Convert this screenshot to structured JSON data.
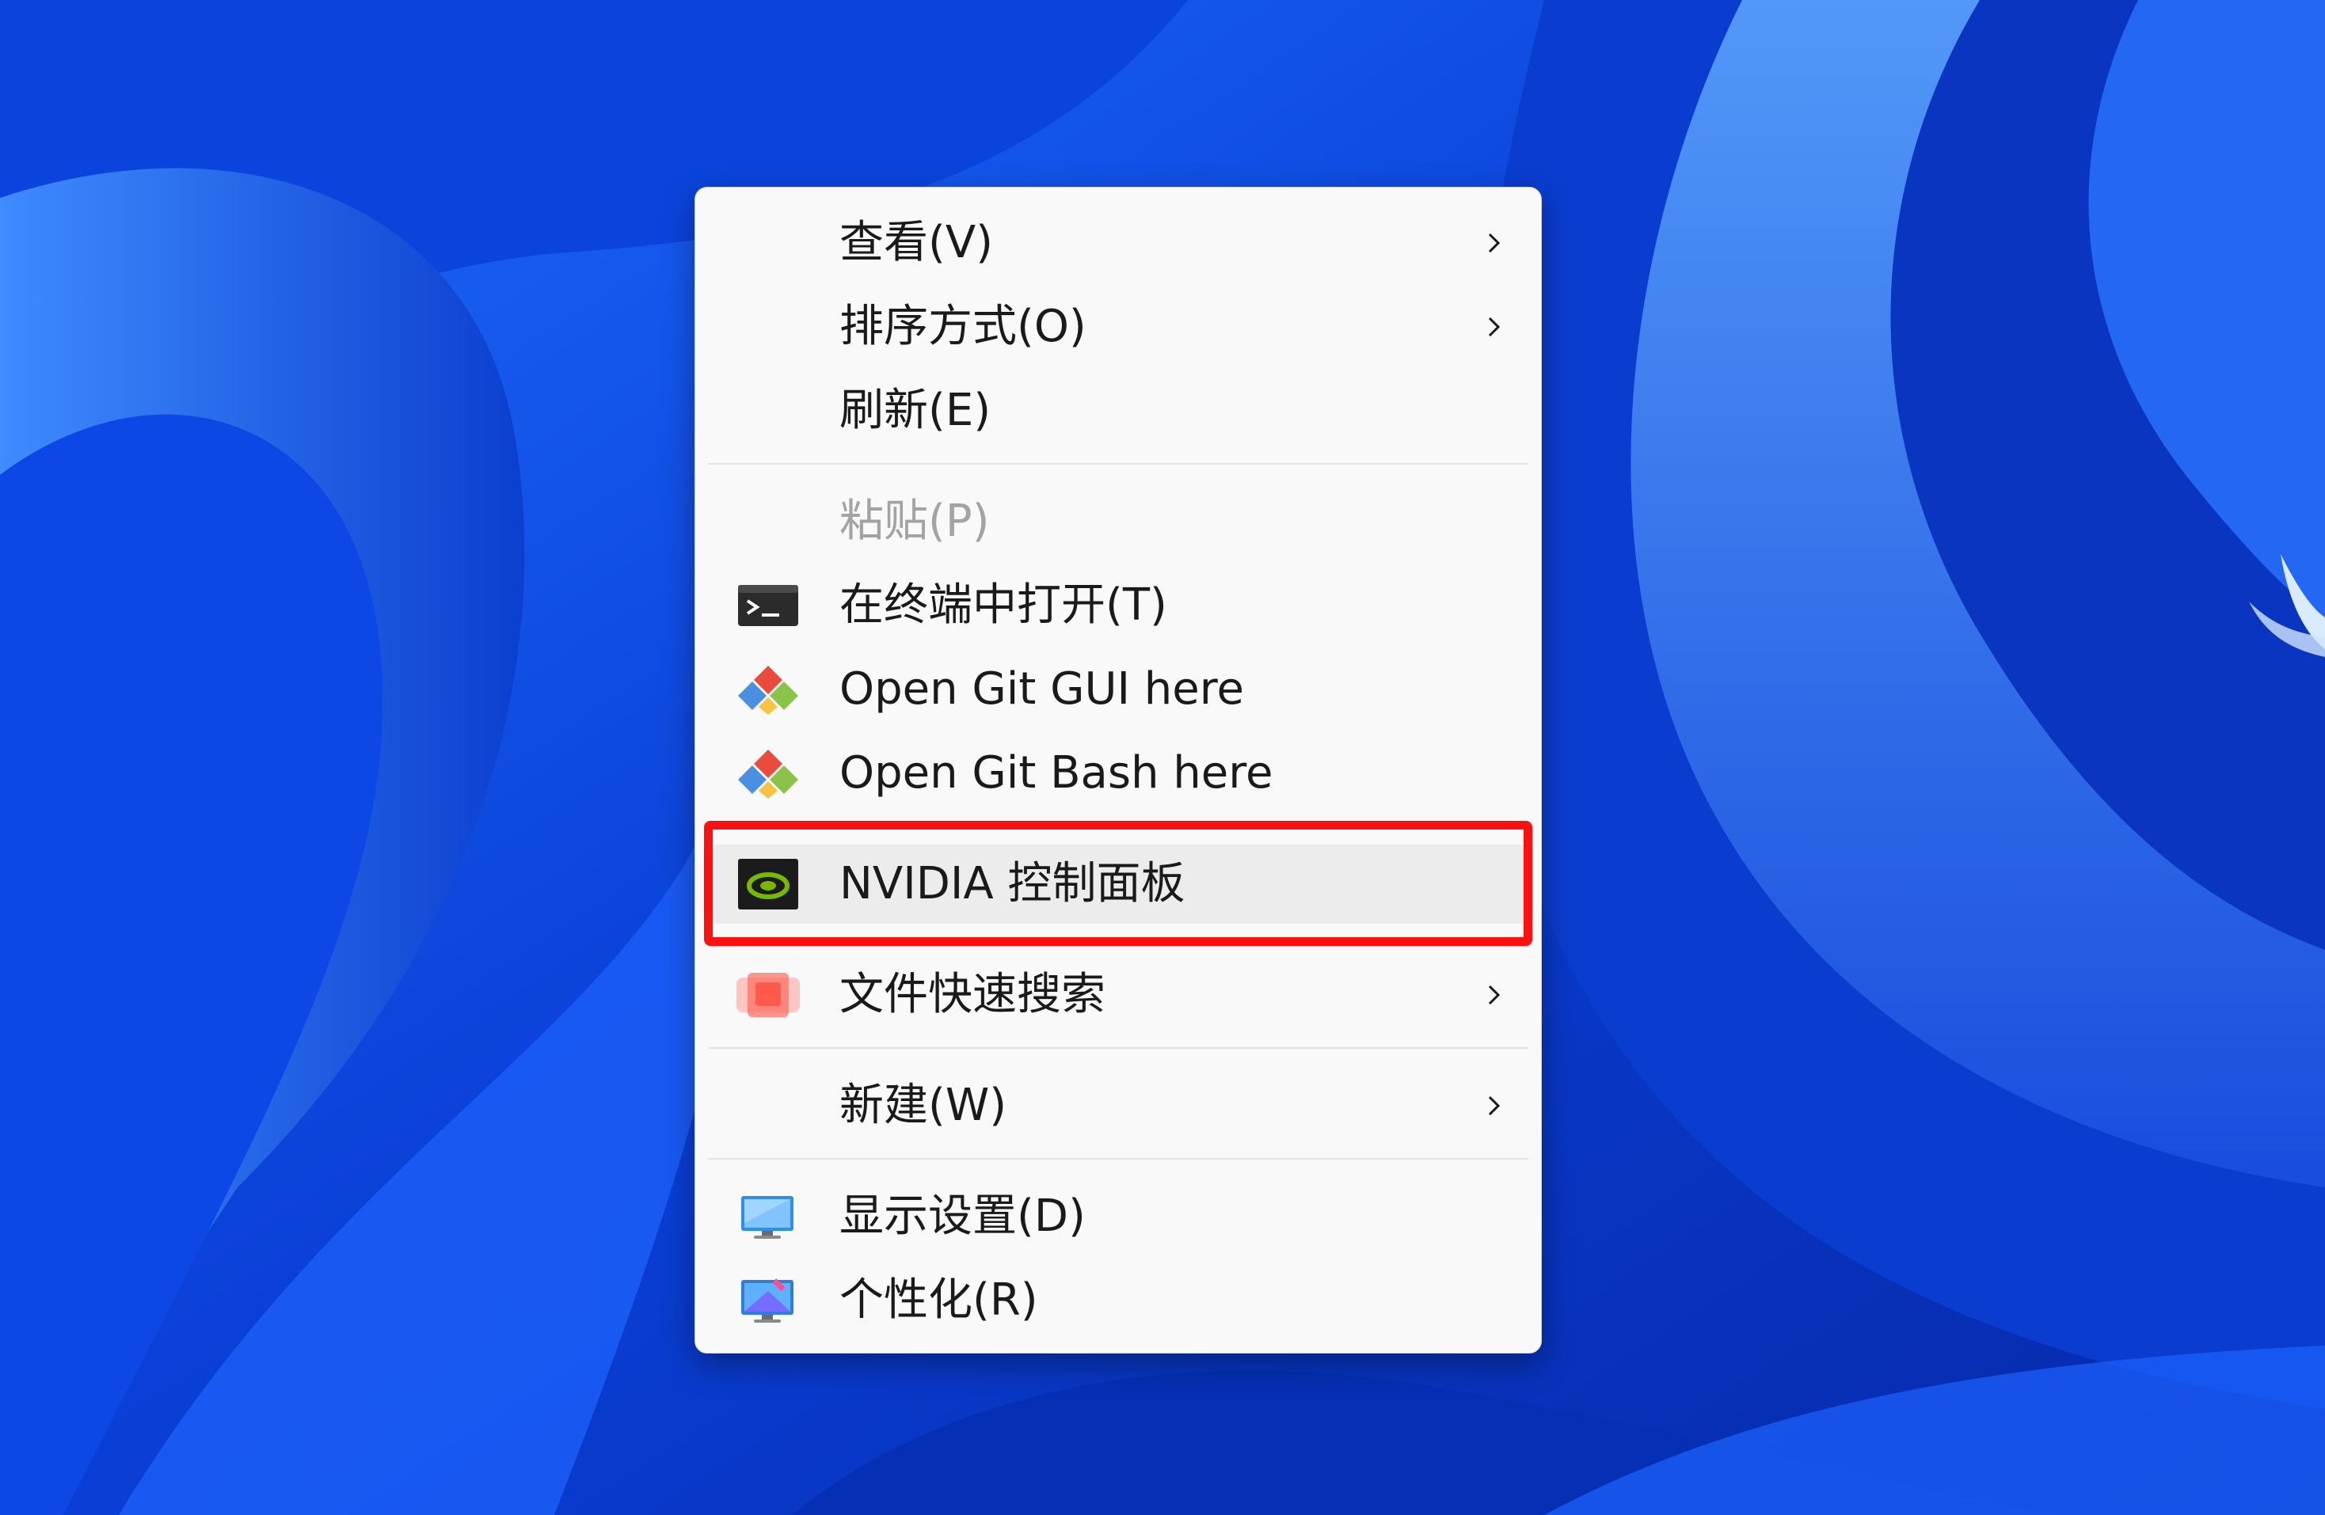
{
  "context_menu": {
    "items": [
      {
        "label": "查看(V)",
        "icon": "none",
        "has_submenu": true,
        "enabled": true
      },
      {
        "label": "排序方式(O)",
        "icon": "none",
        "has_submenu": true,
        "enabled": true
      },
      {
        "label": "刷新(E)",
        "icon": "none",
        "has_submenu": false,
        "enabled": true
      },
      {
        "label": "粘贴(P)",
        "icon": "none",
        "has_submenu": false,
        "enabled": false
      },
      {
        "label": "在终端中打开(T)",
        "icon": "terminal-icon",
        "has_submenu": false,
        "enabled": true
      },
      {
        "label": "Open Git GUI here",
        "icon": "git-icon",
        "has_submenu": false,
        "enabled": true
      },
      {
        "label": "Open Git Bash here",
        "icon": "git-icon",
        "has_submenu": false,
        "enabled": true
      },
      {
        "label": "NVIDIA 控制面板",
        "icon": "nvidia-icon",
        "has_submenu": false,
        "enabled": true,
        "highlighted": true
      },
      {
        "label": "文件快速搜索",
        "icon": "file-search-app-icon",
        "has_submenu": true,
        "enabled": true
      },
      {
        "label": "新建(W)",
        "icon": "none",
        "has_submenu": true,
        "enabled": true
      },
      {
        "label": "显示设置(D)",
        "icon": "display-settings-icon",
        "has_submenu": false,
        "enabled": true
      },
      {
        "label": "个性化(R)",
        "icon": "personalize-icon",
        "has_submenu": false,
        "enabled": true
      }
    ]
  },
  "annotation": {
    "color": "#ff1010",
    "target": "NVIDIA 控制面板"
  },
  "colors": {
    "wallpaper_blue": "#0a36c8",
    "menu_background": "#f9f9f9",
    "text": "#1a1a1a",
    "disabled_text": "#a3a3a3",
    "nvidia_green": "#76b900"
  }
}
